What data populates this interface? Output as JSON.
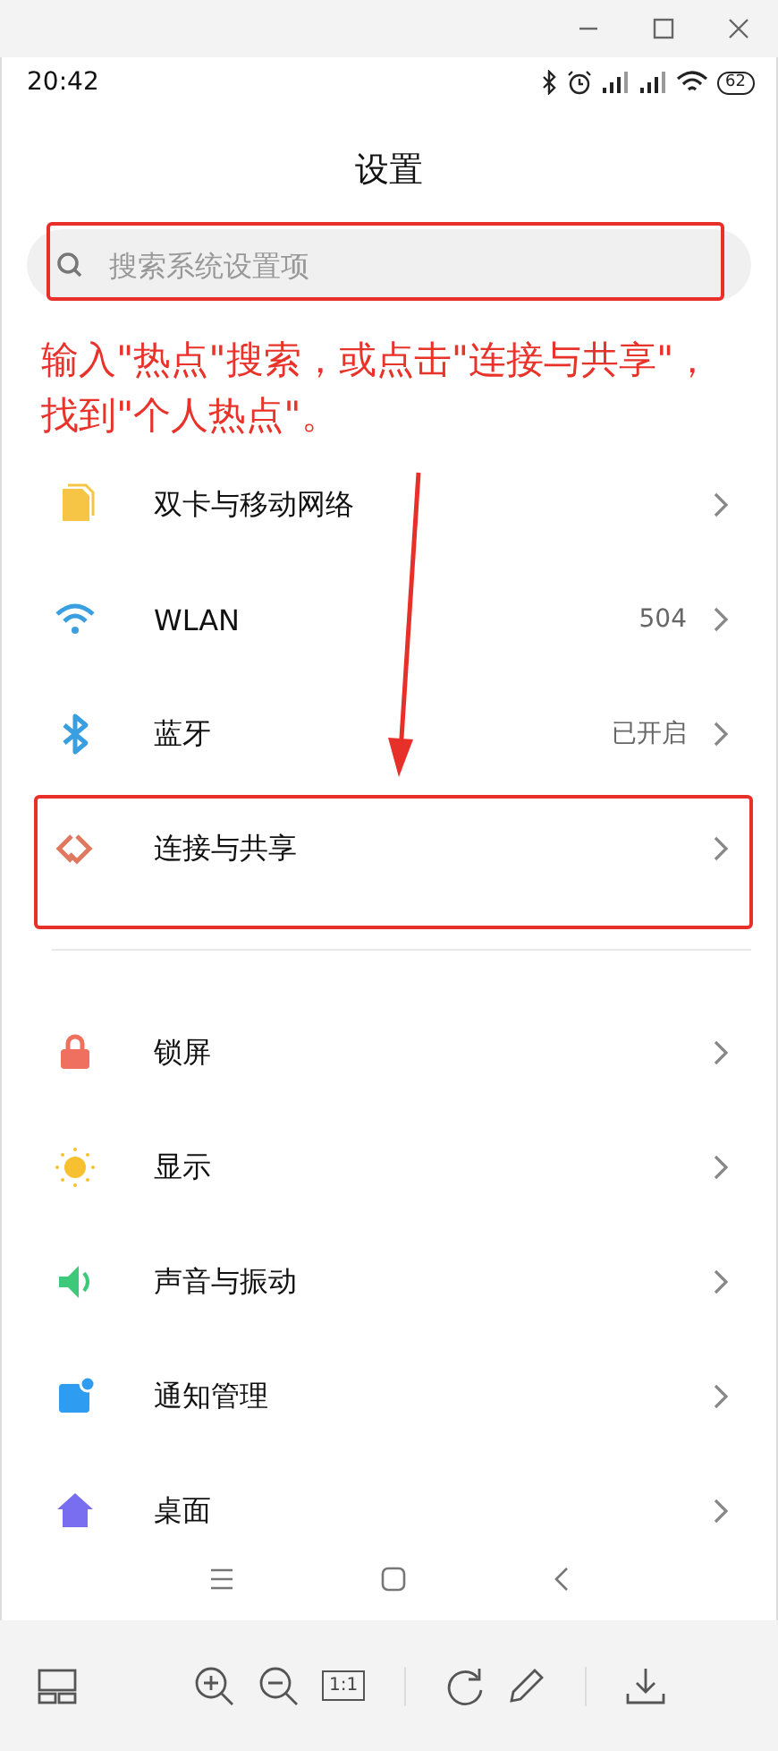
{
  "status_bar": {
    "time": "20:42",
    "battery": "62"
  },
  "page_title": "设置",
  "search": {
    "placeholder": "搜索系统设置项"
  },
  "annotation": "输入\"热点\"搜索，或点击\"连接与共享\"，找到\"个人热点\"。",
  "groups": [
    {
      "items": [
        {
          "label": "双卡与移动网络"
        },
        {
          "label": "WLAN",
          "value": "504"
        },
        {
          "label": "蓝牙",
          "value": "已开启"
        },
        {
          "label": "连接与共享"
        }
      ]
    },
    {
      "items": [
        {
          "label": "锁屏"
        },
        {
          "label": "显示"
        },
        {
          "label": "声音与振动"
        },
        {
          "label": "通知管理"
        },
        {
          "label": "桌面"
        }
      ]
    }
  ],
  "toolbar": {
    "actual_size": "1:1"
  }
}
